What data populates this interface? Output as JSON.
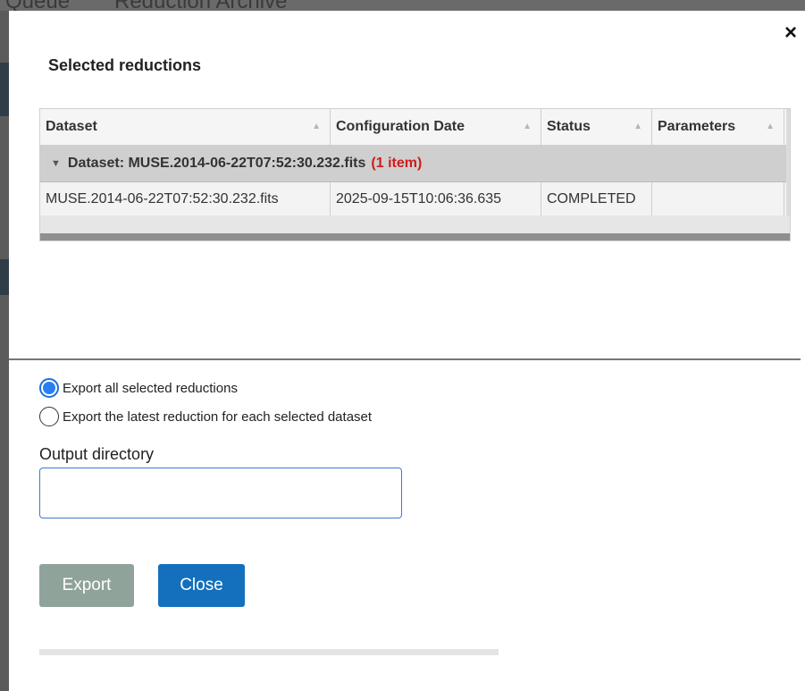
{
  "background": {
    "tabs": [
      "Queue",
      "Reduction Archive"
    ]
  },
  "dialog": {
    "title": "Selected reductions",
    "close_icon": "×",
    "table": {
      "columns": [
        {
          "label": "Dataset",
          "sort_icon": "▲"
        },
        {
          "label": "Configuration Date",
          "sort_icon": "▲"
        },
        {
          "label": "Status",
          "sort_icon": "▲"
        },
        {
          "label": "Parameters",
          "sort_icon": "▲"
        }
      ],
      "group": {
        "expand_icon": "▼",
        "label": "Dataset: MUSE.2014-06-22T07:52:30.232.fits",
        "count": "(1 item)"
      },
      "rows": [
        {
          "dataset": "MUSE.2014-06-22T07:52:30.232.fits",
          "configuration_date": "2025-09-15T10:06:36.635",
          "status": "COMPLETED",
          "parameters": ""
        }
      ]
    },
    "options": [
      {
        "label": "Export all selected reductions",
        "checked": true
      },
      {
        "label": "Export the latest reduction for each selected dataset",
        "checked": false
      }
    ],
    "output_directory": {
      "label": "Output directory",
      "value": ""
    },
    "buttons": {
      "export": "Export",
      "close": "Close"
    }
  },
  "colors": {
    "accent": "#1470bd",
    "export_disabled": "#8fa39a",
    "group_count": "#d01c1c"
  }
}
